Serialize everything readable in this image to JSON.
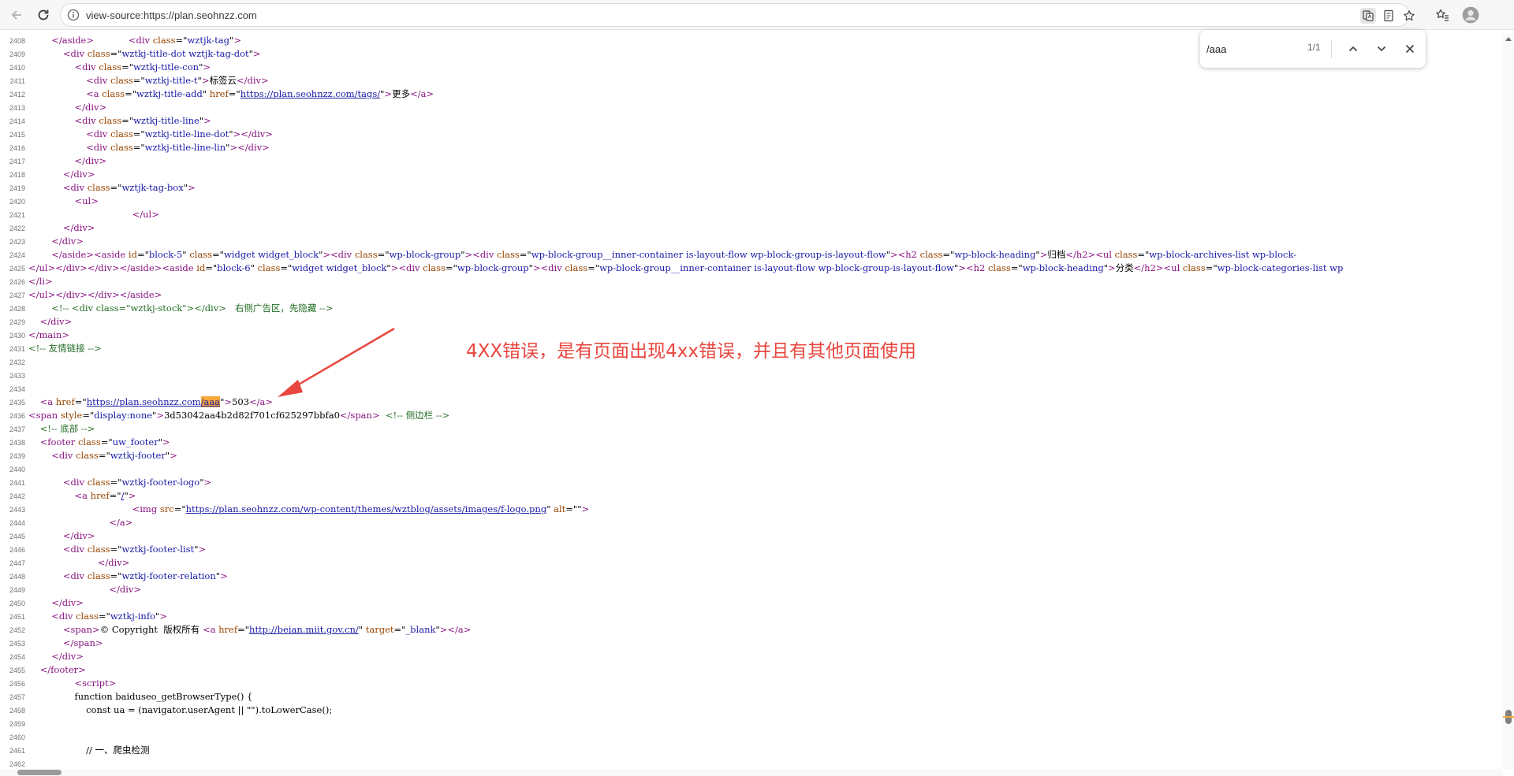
{
  "browser": {
    "url": "view-source:https://plan.seohnzz.com",
    "icons": [
      "back-icon",
      "reload-icon",
      "site-info-icon",
      "translate-icon",
      "reader-mode-icon",
      "bookmark-star-icon",
      "favorites-icon",
      "profile-avatar-icon"
    ]
  },
  "find": {
    "query": "/aaa",
    "count": "1/1",
    "icons": [
      "previous-match-icon",
      "next-match-icon",
      "close-icon"
    ]
  },
  "annotation": {
    "text": "4XX错误，是有页面出现4xx错误，并且有其他页面使用",
    "color": "#e8463e"
  },
  "source": {
    "lines": [
      {
        "n": "2408",
        "html": "        <span class=\"t\">&lt;/aside&gt;</span>            <span class=\"t\">&lt;div</span> <span class=\"a\">class</span>=\"<span class=\"v\">wztjk-tag</span>\"<span class=\"t\">&gt;</span>"
      },
      {
        "n": "2409",
        "html": "            <span class=\"t\">&lt;div</span> <span class=\"a\">class</span>=\"<span class=\"v\">wztkj-title-dot wztjk-tag-dot</span>\"<span class=\"t\">&gt;</span>"
      },
      {
        "n": "2410",
        "html": "                <span class=\"t\">&lt;div</span> <span class=\"a\">class</span>=\"<span class=\"v\">wztkj-title-con</span>\"<span class=\"t\">&gt;</span>"
      },
      {
        "n": "2411",
        "html": "                    <span class=\"t\">&lt;div</span> <span class=\"a\">class</span>=\"<span class=\"v\">wztkj-title-t</span>\"<span class=\"t\">&gt;</span>标签云<span class=\"t\">&lt;/div&gt;</span>"
      },
      {
        "n": "2412",
        "html": "                    <span class=\"t\">&lt;a</span> <span class=\"a\">class</span>=\"<span class=\"v\">wztkj-title-add</span>\" <span class=\"a\">href</span>=\"<span class=\"u\">https://plan.seohnzz.com/tags/</span>\"<span class=\"t\">&gt;</span>更多<span class=\"t\">&lt;/a&gt;</span>"
      },
      {
        "n": "2413",
        "html": "                <span class=\"t\">&lt;/div&gt;</span>"
      },
      {
        "n": "2414",
        "html": "                <span class=\"t\">&lt;div</span> <span class=\"a\">class</span>=\"<span class=\"v\">wztkj-title-line</span>\"<span class=\"t\">&gt;</span>"
      },
      {
        "n": "2415",
        "html": "                    <span class=\"t\">&lt;div</span> <span class=\"a\">class</span>=\"<span class=\"v\">wztkj-title-line-dot</span>\"<span class=\"t\">&gt;&lt;/div&gt;</span>"
      },
      {
        "n": "2416",
        "html": "                    <span class=\"t\">&lt;div</span> <span class=\"a\">class</span>=\"<span class=\"v\">wztkj-title-line-lin</span>\"<span class=\"t\">&gt;&lt;/div&gt;</span>"
      },
      {
        "n": "2417",
        "html": "                <span class=\"t\">&lt;/div&gt;</span>"
      },
      {
        "n": "2418",
        "html": "            <span class=\"t\">&lt;/div&gt;</span>"
      },
      {
        "n": "2419",
        "html": "            <span class=\"t\">&lt;div</span> <span class=\"a\">class</span>=\"<span class=\"v\">wztjk-tag-box</span>\"<span class=\"t\">&gt;</span>"
      },
      {
        "n": "2420",
        "html": "                <span class=\"t\">&lt;ul&gt;</span>"
      },
      {
        "n": "2421",
        "html": "                                    <span class=\"t\">&lt;/ul&gt;</span>"
      },
      {
        "n": "2422",
        "html": "            <span class=\"t\">&lt;/div&gt;</span>"
      },
      {
        "n": "2423",
        "html": "        <span class=\"t\">&lt;/div&gt;</span>"
      },
      {
        "n": "2424",
        "html": "        <span class=\"t\">&lt;/aside&gt;&lt;aside</span> <span class=\"a\">id</span>=\"<span class=\"v\">block-5</span>\" <span class=\"a\">class</span>=\"<span class=\"v\">widget widget_block</span>\"<span class=\"t\">&gt;&lt;div</span> <span class=\"a\">class</span>=\"<span class=\"v\">wp-block-group</span>\"<span class=\"t\">&gt;&lt;div</span> <span class=\"a\">class</span>=\"<span class=\"v\">wp-block-group__inner-container is-layout-flow wp-block-group-is-layout-flow</span>\"<span class=\"t\">&gt;&lt;h2</span> <span class=\"a\">class</span>=\"<span class=\"v\">wp-block-heading</span>\"<span class=\"t\">&gt;</span>归档<span class=\"t\">&lt;/h2&gt;&lt;ul</span> <span class=\"a\">class</span>=\"<span class=\"v\">wp-block-archives-list wp-block-</span>"
      },
      {
        "n": "2425",
        "html": "<span class=\"t\">&lt;/ul&gt;&lt;/div&gt;&lt;/div&gt;&lt;/aside&gt;&lt;aside</span> <span class=\"a\">id</span>=\"<span class=\"v\">block-6</span>\" <span class=\"a\">class</span>=\"<span class=\"v\">widget widget_block</span>\"<span class=\"t\">&gt;&lt;div</span> <span class=\"a\">class</span>=\"<span class=\"v\">wp-block-group</span>\"<span class=\"t\">&gt;&lt;div</span> <span class=\"a\">class</span>=\"<span class=\"v\">wp-block-group__inner-container is-layout-flow wp-block-group-is-layout-flow</span>\"<span class=\"t\">&gt;&lt;h2</span> <span class=\"a\">class</span>=\"<span class=\"v\">wp-block-heading</span>\"<span class=\"t\">&gt;</span>分类<span class=\"t\">&lt;/h2&gt;&lt;ul</span> <span class=\"a\">class</span>=\"<span class=\"v\">wp-block-categories-list wp</span>"
      },
      {
        "n": "2426",
        "html": "<span class=\"t\">&lt;/li&gt;</span>"
      },
      {
        "n": "2427",
        "html": "<span class=\"t\">&lt;/ul&gt;&lt;/div&gt;&lt;/div&gt;&lt;/aside&gt;</span>"
      },
      {
        "n": "2428",
        "html": "        <span class=\"c\">&lt;!-- &lt;div class=\"wztkj-stock\"&gt;&lt;/div&gt;   右侧广告区，先隐藏 --&gt;</span>"
      },
      {
        "n": "2429",
        "html": "    <span class=\"t\">&lt;/div&gt;</span>"
      },
      {
        "n": "2430",
        "html": "<span class=\"t\">&lt;/main&gt;</span>"
      },
      {
        "n": "2431",
        "html": "<span class=\"c\">&lt;!-- 友情链接 --&gt;</span>"
      },
      {
        "n": "2432",
        "html": ""
      },
      {
        "n": "2433",
        "html": ""
      },
      {
        "n": "2434",
        "html": ""
      },
      {
        "n": "2435",
        "html": "    <span class=\"t\">&lt;a</span> <span class=\"a\">href</span>=\"<span class=\"u\">https://plan.seohnzz.com<span class=\"hl\">/aaa</span></span>\"<span class=\"t\">&gt;</span>503<span class=\"t\">&lt;/a&gt;</span>"
      },
      {
        "n": "2436",
        "html": "<span class=\"t\">&lt;span</span> <span class=\"a\">style</span>=\"<span class=\"v\">display:none</span>\"<span class=\"t\">&gt;</span>3d53042aa4b2d82f701cf625297bbfa0<span class=\"t\">&lt;/span&gt;</span>  <span class=\"c\">&lt;!-- 侧边栏 --&gt;</span>"
      },
      {
        "n": "2437",
        "html": "    <span class=\"c\">&lt;!-- 底部 --&gt;</span>"
      },
      {
        "n": "2438",
        "html": "    <span class=\"t\">&lt;footer</span> <span class=\"a\">class</span>=\"<span class=\"v\">uw_footer</span>\"<span class=\"t\">&gt;</span>"
      },
      {
        "n": "2439",
        "html": "        <span class=\"t\">&lt;div</span> <span class=\"a\">class</span>=\"<span class=\"v\">wztkj-footer</span>\"<span class=\"t\">&gt;</span>"
      },
      {
        "n": "2440",
        "html": ""
      },
      {
        "n": "2441",
        "html": "            <span class=\"t\">&lt;div</span> <span class=\"a\">class</span>=\"<span class=\"v\">wztkj-footer-logo</span>\"<span class=\"t\">&gt;</span>"
      },
      {
        "n": "2442",
        "html": "                <span class=\"t\">&lt;a</span> <span class=\"a\">href</span>=\"<span class=\"u\">/</span>\"<span class=\"t\">&gt;</span>"
      },
      {
        "n": "2443",
        "html": "                                    <span class=\"t\">&lt;img</span> <span class=\"a\">src</span>=\"<span class=\"u\">https://plan.seohnzz.com/wp-content/themes/wztblog/assets/images/f-logo.png</span>\" <span class=\"a\">alt</span>=\"\"<span class=\"t\">&gt;</span>"
      },
      {
        "n": "2444",
        "html": "                            <span class=\"t\">&lt;/a&gt;</span>"
      },
      {
        "n": "2445",
        "html": "            <span class=\"t\">&lt;/div&gt;</span>"
      },
      {
        "n": "2446",
        "html": "            <span class=\"t\">&lt;div</span> <span class=\"a\">class</span>=\"<span class=\"v\">wztkj-footer-list</span>\"<span class=\"t\">&gt;</span>"
      },
      {
        "n": "2447",
        "html": "                        <span class=\"t\">&lt;/div&gt;</span>"
      },
      {
        "n": "2448",
        "html": "            <span class=\"t\">&lt;div</span> <span class=\"a\">class</span>=\"<span class=\"v\">wztkj-footer-relation</span>\"<span class=\"t\">&gt;</span>"
      },
      {
        "n": "2449",
        "html": "                            <span class=\"t\">&lt;/div&gt;</span>"
      },
      {
        "n": "2450",
        "html": "        <span class=\"t\">&lt;/div&gt;</span>"
      },
      {
        "n": "2451",
        "html": "        <span class=\"t\">&lt;div</span> <span class=\"a\">class</span>=\"<span class=\"v\">wztkj-info</span>\"<span class=\"t\">&gt;</span>"
      },
      {
        "n": "2452",
        "html": "            <span class=\"t\">&lt;span&gt;</span>© Copyright  版权所有 <span class=\"t\">&lt;a</span> <span class=\"a\">href</span>=\"<span class=\"u\">http://beian.miit.gov.cn/</span>\" <span class=\"a\">target</span>=\"<span class=\"v\">_blank</span>\"<span class=\"t\">&gt;&lt;/a&gt;</span>"
      },
      {
        "n": "2453",
        "html": "            <span class=\"t\">&lt;/span&gt;</span>"
      },
      {
        "n": "2454",
        "html": "        <span class=\"t\">&lt;/div&gt;</span>"
      },
      {
        "n": "2455",
        "html": "    <span class=\"t\">&lt;/footer&gt;</span>"
      },
      {
        "n": "2456",
        "html": "                <span class=\"t\">&lt;script&gt;</span>"
      },
      {
        "n": "2457",
        "html": "                function baiduseo_getBrowserType() {"
      },
      {
        "n": "2458",
        "html": "                    const ua = (navigator.userAgent || \"\").toLowerCase();"
      },
      {
        "n": "2459",
        "html": ""
      },
      {
        "n": "2460",
        "html": ""
      },
      {
        "n": "2461",
        "html": "                    // 一、爬虫检测"
      },
      {
        "n": "2462",
        "html": ""
      }
    ]
  }
}
